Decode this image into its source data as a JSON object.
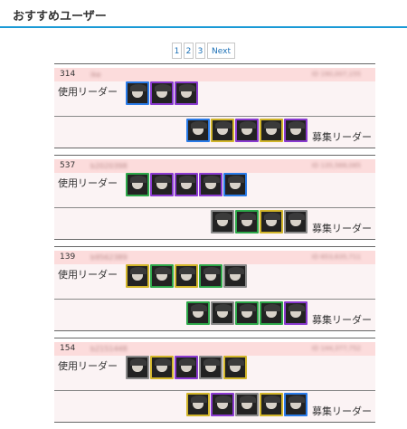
{
  "header": {
    "title": "おすすめユーザー"
  },
  "pagination": {
    "pages": [
      "1",
      "2",
      "3"
    ],
    "next_label": "Next"
  },
  "labels": {
    "leader": "使用リーダー",
    "recruit": "募集リーダー"
  },
  "users": [
    {
      "rank": "314",
      "name": "ike",
      "id": "ID 190,007,155",
      "leaders": [
        {
          "icon": "dark-character-icon",
          "frame": "#2a7be8"
        },
        {
          "icon": "dark-character-icon",
          "frame": "#8a3ad0"
        },
        {
          "icon": "dark-character-icon",
          "frame": "#8a3ad0"
        }
      ],
      "recruits": [
        {
          "icon": "dark-character-icon",
          "frame": "#2a7be8"
        },
        {
          "icon": "light-character-icon",
          "frame": "#d1b52a"
        },
        {
          "icon": "dark-character-icon",
          "frame": "#8a3ad0"
        },
        {
          "icon": "light-character-icon",
          "frame": "#d1b52a"
        },
        {
          "icon": "dark-character-icon",
          "frame": "#8a3ad0"
        }
      ]
    },
    {
      "rank": "537",
      "name": "b2020398",
      "id": "ID 135,568,085",
      "leaders": [
        {
          "icon": "wood-character-icon",
          "frame": "#2ea84a"
        },
        {
          "icon": "dark-character-icon",
          "frame": "#8a3ad0"
        },
        {
          "icon": "dark-character-icon",
          "frame": "#8a3ad0"
        },
        {
          "icon": "dark-character-icon",
          "frame": "#8a3ad0"
        },
        {
          "icon": "water-character-icon",
          "frame": "#2a7be8"
        }
      ],
      "recruits": [
        {
          "icon": "robot-character-icon",
          "frame": "#8a8a8a"
        },
        {
          "icon": "wood-character-icon",
          "frame": "#2ea84a"
        },
        {
          "icon": "light-character-icon",
          "frame": "#d1b52a"
        },
        {
          "icon": "robot-character-icon",
          "frame": "#8a8a8a"
        }
      ]
    },
    {
      "rank": "139",
      "name": "b9562389",
      "id": "ID 653,635,711",
      "leaders": [
        {
          "icon": "light-character-icon",
          "frame": "#d1b52a"
        },
        {
          "icon": "wood-character-icon",
          "frame": "#2ea84a"
        },
        {
          "icon": "light-character-icon",
          "frame": "#d1b52a"
        },
        {
          "icon": "wood-character-icon",
          "frame": "#2ea84a"
        },
        {
          "icon": "dark-character-icon",
          "frame": "#8a8a8a"
        }
      ],
      "recruits": [
        {
          "icon": "wood-character-icon",
          "frame": "#2ea84a"
        },
        {
          "icon": "dark-character-icon",
          "frame": "#8a8a8a"
        },
        {
          "icon": "wood-character-icon",
          "frame": "#2ea84a"
        },
        {
          "icon": "wood-character-icon",
          "frame": "#2ea84a"
        },
        {
          "icon": "dark-character-icon",
          "frame": "#8a3ad0"
        }
      ]
    },
    {
      "rank": "154",
      "name": "b2151448",
      "id": "ID 144,377,752",
      "leaders": [
        {
          "icon": "dark-character-icon",
          "frame": "#8a8a8a"
        },
        {
          "icon": "light-character-icon",
          "frame": "#d1b52a"
        },
        {
          "icon": "dark-character-icon",
          "frame": "#8a3ad0"
        },
        {
          "icon": "robot-character-icon",
          "frame": "#8a8a8a"
        },
        {
          "icon": "light-character-icon",
          "frame": "#d1b52a"
        }
      ],
      "recruits": [
        {
          "icon": "light-character-icon",
          "frame": "#d1b52a"
        },
        {
          "icon": "dark-character-icon",
          "frame": "#8a3ad0"
        },
        {
          "icon": "dark-character-icon",
          "frame": "#8a8a8a"
        },
        {
          "icon": "light-character-icon",
          "frame": "#d1b52a"
        },
        {
          "icon": "water-character-icon",
          "frame": "#2a7be8"
        }
      ]
    }
  ]
}
